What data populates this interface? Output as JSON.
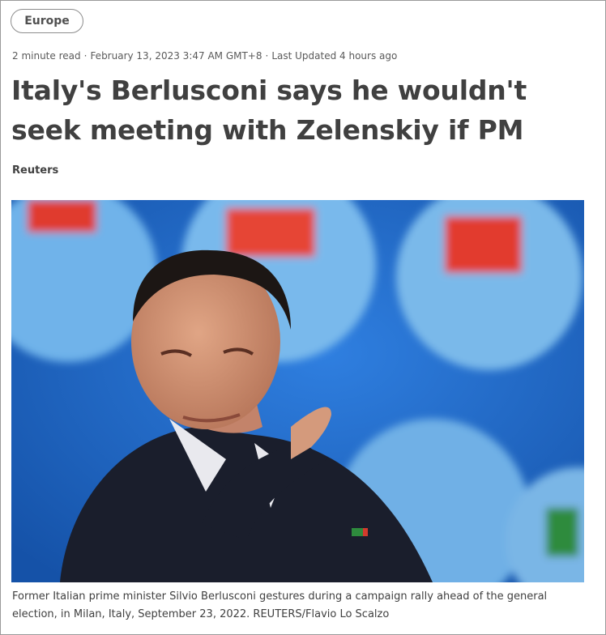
{
  "section": {
    "label": "Europe"
  },
  "meta": {
    "read_time": "2 minute read",
    "published": "February 13, 2023 3:47 AM GMT+8",
    "updated": "Last Updated 4 hours ago",
    "separator": "·"
  },
  "article": {
    "headline": "Italy's Berlusconi says he wouldn't seek meeting with Zelenskiy if PM",
    "byline": "Reuters"
  },
  "image": {
    "caption": "Former Italian prime minister Silvio Berlusconi gestures during a campaign rally ahead of the general election, in Milan, Italy, September 23, 2022. REUTERS/Flavio Lo Scalzo",
    "background_color": "#1d63c4"
  }
}
